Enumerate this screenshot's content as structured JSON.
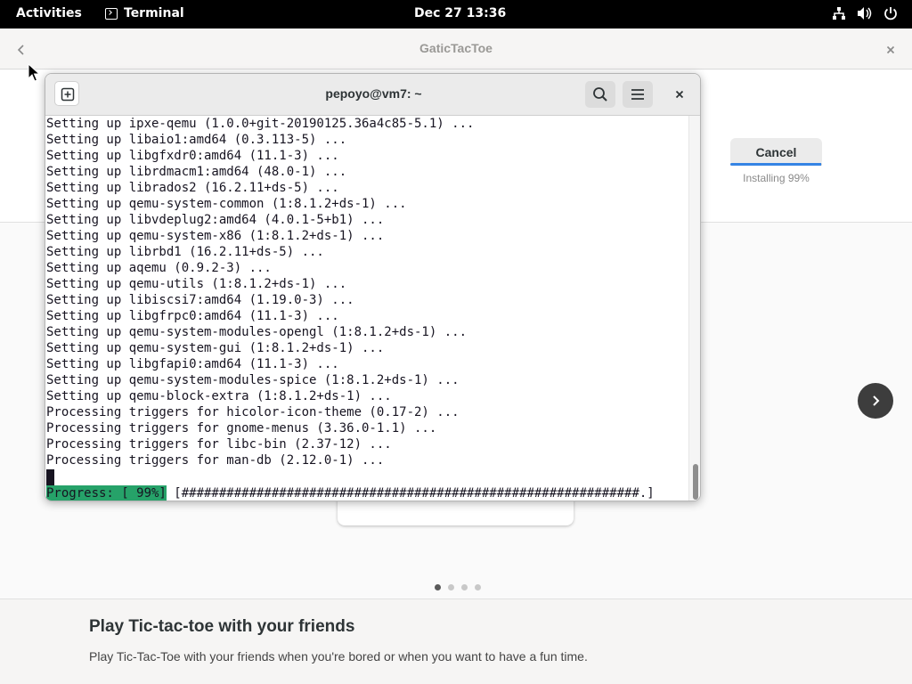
{
  "topbar": {
    "activities_label": "Activities",
    "app_label": "Terminal",
    "app_icon": "terminal-icon",
    "clock": "Dec 27  13:36",
    "tray_icons": [
      "network-icon",
      "volume-icon",
      "power-icon"
    ]
  },
  "software": {
    "window_title": "GaticTacToe",
    "cancel_label": "Cancel",
    "install_progress": 0.99,
    "install_status": "Installing 99%",
    "carousel": {
      "dots": 4,
      "active": 0
    },
    "description_heading": "Play Tic-tac-toe with your friends",
    "description_body": "Play Tic-Tac-Toe with your friends when you're bored or when you want to have a fun time."
  },
  "terminal": {
    "title": "pepoyo@vm7: ~",
    "lines": [
      "Setting up ipxe-qemu (1.0.0+git-20190125.36a4c85-5.1) ...",
      "Setting up libaio1:amd64 (0.3.113-5) ...",
      "Setting up libgfxdr0:amd64 (11.1-3) ...",
      "Setting up librdmacm1:amd64 (48.0-1) ...",
      "Setting up librados2 (16.2.11+ds-5) ...",
      "Setting up qemu-system-common (1:8.1.2+ds-1) ...",
      "Setting up libvdeplug2:amd64 (4.0.1-5+b1) ...",
      "Setting up qemu-system-x86 (1:8.1.2+ds-1) ...",
      "Setting up librbd1 (16.2.11+ds-5) ...",
      "Setting up aqemu (0.9.2-3) ...",
      "Setting up qemu-utils (1:8.1.2+ds-1) ...",
      "Setting up libiscsi7:amd64 (1.19.0-3) ...",
      "Setting up libgfrpc0:amd64 (11.1-3) ...",
      "Setting up qemu-system-modules-opengl (1:8.1.2+ds-1) ...",
      "Setting up qemu-system-gui (1:8.1.2+ds-1) ...",
      "Setting up libgfapi0:amd64 (11.1-3) ...",
      "Setting up qemu-system-modules-spice (1:8.1.2+ds-1) ...",
      "Setting up qemu-block-extra (1:8.1.2+ds-1) ...",
      "Processing triggers for hicolor-icon-theme (0.17-2) ...",
      "Processing triggers for gnome-menus (3.36.0-1.1) ...",
      "Processing triggers for libc-bin (2.37-12) ...",
      "Processing triggers for man-db (2.12.0-1) ..."
    ],
    "progress_label": "Progress: [ 99%]",
    "progress_bar": " [#############################################################.]"
  },
  "colors": {
    "topbar_bg": "#000000",
    "progress_green": "#26a269",
    "accent_blue": "#3584e4"
  }
}
